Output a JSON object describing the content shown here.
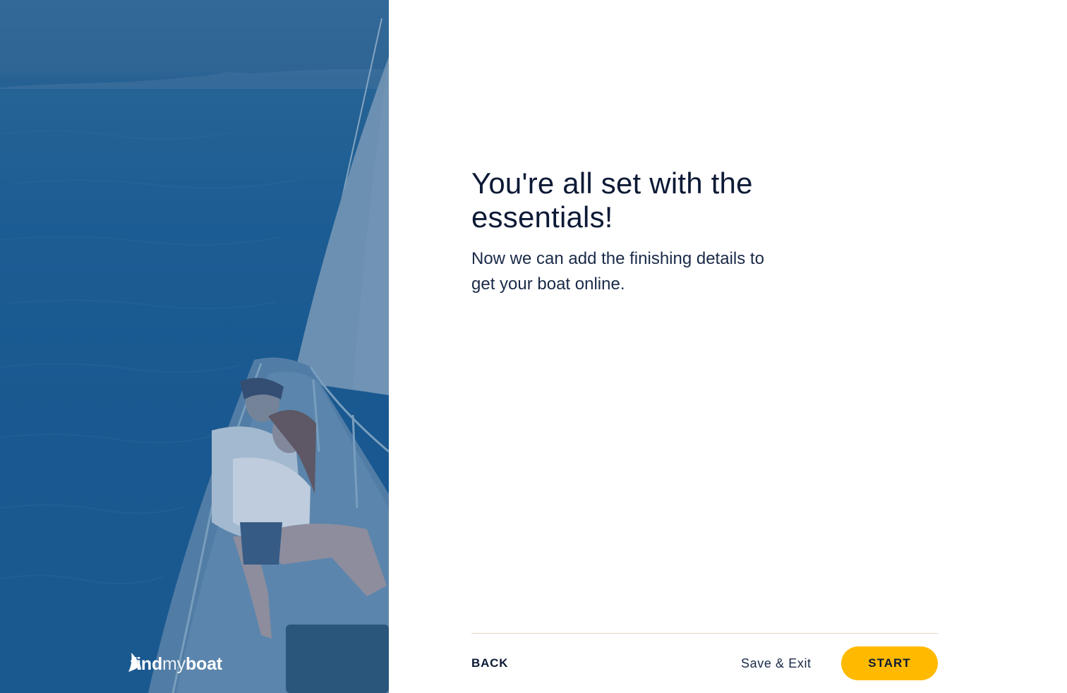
{
  "hero": {
    "image_icon": "couple-on-sailboat-photo",
    "overlay_color": "#1b5c92"
  },
  "brand": {
    "word_find": "find",
    "word_my": "my",
    "word_boat": "boat",
    "icon": "sail-logo-icon"
  },
  "main": {
    "title": "You're all set with the essentials!",
    "subtitle": "Now we can add the finishing details to get your boat online."
  },
  "footer": {
    "back_label": "BACK",
    "save_label": "Save & Exit",
    "start_label": "START",
    "start_color": "#ffba00",
    "divider_color": "#e8d9c4"
  }
}
